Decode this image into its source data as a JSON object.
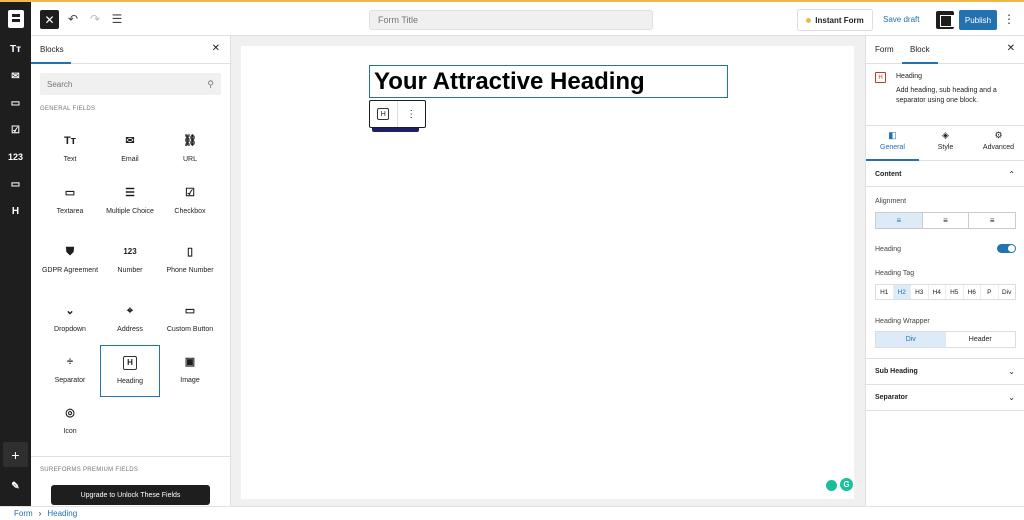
{
  "topbar": {
    "form_title_placeholder": "Form Title",
    "instant_form": "Instant Form",
    "save_draft": "Save draft",
    "publish": "Publish",
    "more": "⋮",
    "close": "✕",
    "undo": "↶",
    "redo": "↷",
    "list": "☰"
  },
  "rail": {
    "items": [
      "Tт",
      "✉",
      "▭",
      "☑",
      "123",
      "▭",
      "H"
    ],
    "plus": "+",
    "pen": "✎"
  },
  "left_panel": {
    "tab": "Blocks",
    "close": "✕",
    "search_placeholder": "Search",
    "general_fields_label": "GENERAL FIELDS",
    "premium_label": "SUREFORMS PREMIUM FIELDS",
    "upgrade": "Upgrade to Unlock These Fields",
    "blocks": [
      {
        "label": "Text",
        "icon": "Tт"
      },
      {
        "label": "Email",
        "icon": "✉"
      },
      {
        "label": "URL",
        "icon": "⛓"
      },
      {
        "label": "Textarea",
        "icon": "▭"
      },
      {
        "label": "Multiple Choice",
        "icon": "☰"
      },
      {
        "label": "Checkbox",
        "icon": "☑"
      },
      {
        "label": "GDPR Agreement",
        "icon": "⛊"
      },
      {
        "label": "Number",
        "icon": "123"
      },
      {
        "label": "Phone Number",
        "icon": "▯"
      },
      {
        "label": "Dropdown",
        "icon": "⌄"
      },
      {
        "label": "Address",
        "icon": "⌖"
      },
      {
        "label": "Custom Button",
        "icon": "▭"
      },
      {
        "label": "Separator",
        "icon": "÷"
      },
      {
        "label": "Heading",
        "icon": "H"
      },
      {
        "label": "Image",
        "icon": "▣"
      },
      {
        "label": "Icon",
        "icon": "◎"
      }
    ]
  },
  "canvas": {
    "heading": "Your Attractive Heading",
    "toolbar_h": "H",
    "toolbar_more": "⋮"
  },
  "right_panel": {
    "tab_form": "Form",
    "tab_block": "Block",
    "close": "✕",
    "block_name": "Heading",
    "block_desc": "Add heading, sub heading and a separator using one block.",
    "subtabs": [
      {
        "label": "General",
        "icon": "◧"
      },
      {
        "label": "Style",
        "icon": "◈"
      },
      {
        "label": "Advanced",
        "icon": "⚙"
      }
    ],
    "content_label": "Content",
    "alignment_label": "Alignment",
    "heading_label": "Heading",
    "heading_tag_label": "Heading Tag",
    "heading_tags": [
      "H1",
      "H2",
      "H3",
      "H4",
      "H5",
      "H6",
      "P",
      "Div"
    ],
    "heading_tag_selected": "H2",
    "heading_wrapper_label": "Heading Wrapper",
    "wrapper_options": [
      "Div",
      "Header"
    ],
    "sub_heading_label": "Sub Heading",
    "separator_label": "Separator"
  },
  "footer": {
    "crumb1": "Form",
    "sep": "›",
    "crumb2": "Heading"
  },
  "colors": {
    "accent": "#2271b1",
    "dark": "#1e1e1e"
  }
}
